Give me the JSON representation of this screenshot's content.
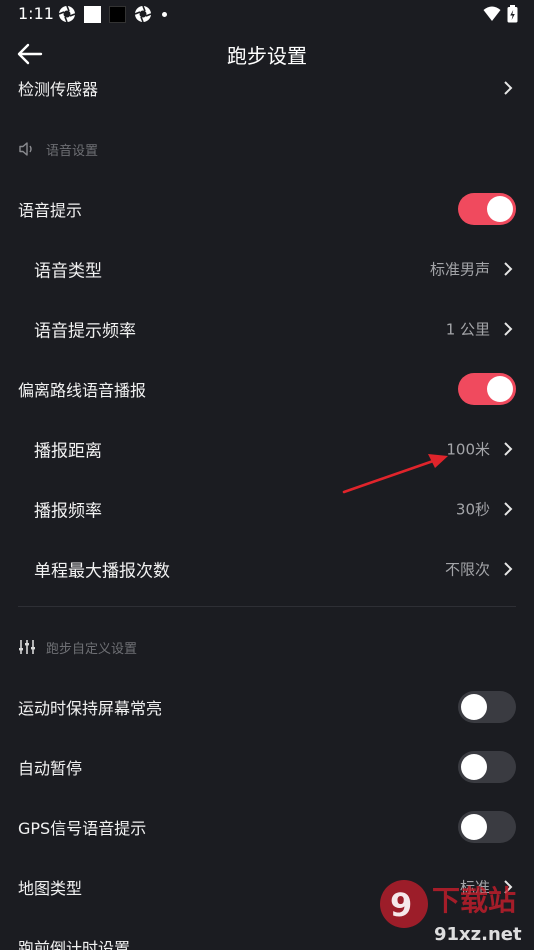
{
  "status_bar": {
    "time": "1:11"
  },
  "header": {
    "title": "跑步设置"
  },
  "rows": {
    "sensor": {
      "label": "检测传感器"
    },
    "voice_prompt": {
      "label": "语音提示"
    },
    "voice_type": {
      "label": "语音类型",
      "value": "标准男声"
    },
    "voice_freq": {
      "label": "语音提示频率",
      "value": "1 公里"
    },
    "deviation": {
      "label": "偏离路线语音播报"
    },
    "report_distance": {
      "label": "播报距离",
      "value": "100米"
    },
    "report_freq": {
      "label": "播报频率",
      "value": "30秒"
    },
    "max_reports": {
      "label": "单程最大播报次数",
      "value": "不限次"
    },
    "screen_on": {
      "label": "运动时保持屏幕常亮"
    },
    "auto_pause": {
      "label": "自动暂停"
    },
    "gps_voice": {
      "label": "GPS信号语音提示"
    },
    "map_type": {
      "label": "地图类型",
      "value": "标准"
    },
    "countdown": {
      "label": "跑前倒计时设置"
    }
  },
  "sections": {
    "voice": {
      "label": "语音设置"
    },
    "custom": {
      "label": "跑步自定义设置"
    }
  },
  "toggles": {
    "voice_prompt": true,
    "deviation": true,
    "screen_on": false,
    "auto_pause": false,
    "gps_voice": false
  },
  "watermark": {
    "main": "下载站",
    "url": "91xz.net"
  },
  "colors": {
    "background": "#1b1c21",
    "accent": "#f04a5e",
    "toggle_off": "#3a3b41",
    "secondary_text": "#a3a4a8",
    "annotation_arrow": "#e0242b"
  }
}
